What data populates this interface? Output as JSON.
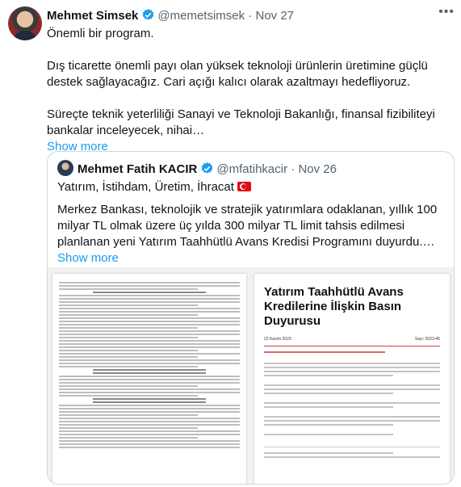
{
  "tweet": {
    "author_name": "Mehmet Simsek",
    "handle": "@memetsimsek",
    "separator": "·",
    "date": "Nov 27",
    "more_icon": "•••",
    "paragraphs": [
      "Önemli bir program.",
      "Dış ticarette önemli payı olan yüksek teknoloji ürünlerin üretimine güçlü destek sağlayacağız. Cari açığı kalıcı olarak azaltmayı hedefliyoruz.",
      "Süreçte teknik yeterliliği Sanayi ve Teknoloji Bakanlığı, finansal fizibiliteyi bankalar inceleyecek, nihai…"
    ],
    "show_more": "Show more"
  },
  "quote": {
    "author_name": "Mehmet Fatih KACIR",
    "handle": "@mfatihkacir",
    "separator": "·",
    "date": "Nov 26",
    "first_line": "Yatırım, İstihdam, Üretim, İhracat",
    "flag_icon": "turkey-flag-icon",
    "body": "Merkez Bankası, teknolojik ve stratejik yatırımlara odaklanan, yıllık 100 milyar TL olmak üzere üç yılda 300 milyar TL limit tahsis edilmesi planlanan yeni Yatırım Taahhütlü Avans Kredisi Programını duyurdu.…",
    "show_more": "Show more"
  },
  "documents": {
    "right_title": "Yatırım Taahhütlü Avans Kredilerine İlişkin Basın Duyurusu",
    "right_date": "22 Kasım 2023",
    "right_number": "Sayı: 2023-45"
  },
  "colors": {
    "link": "#1d9bf0",
    "verified": "#1d9bf0",
    "muted": "#536471"
  }
}
